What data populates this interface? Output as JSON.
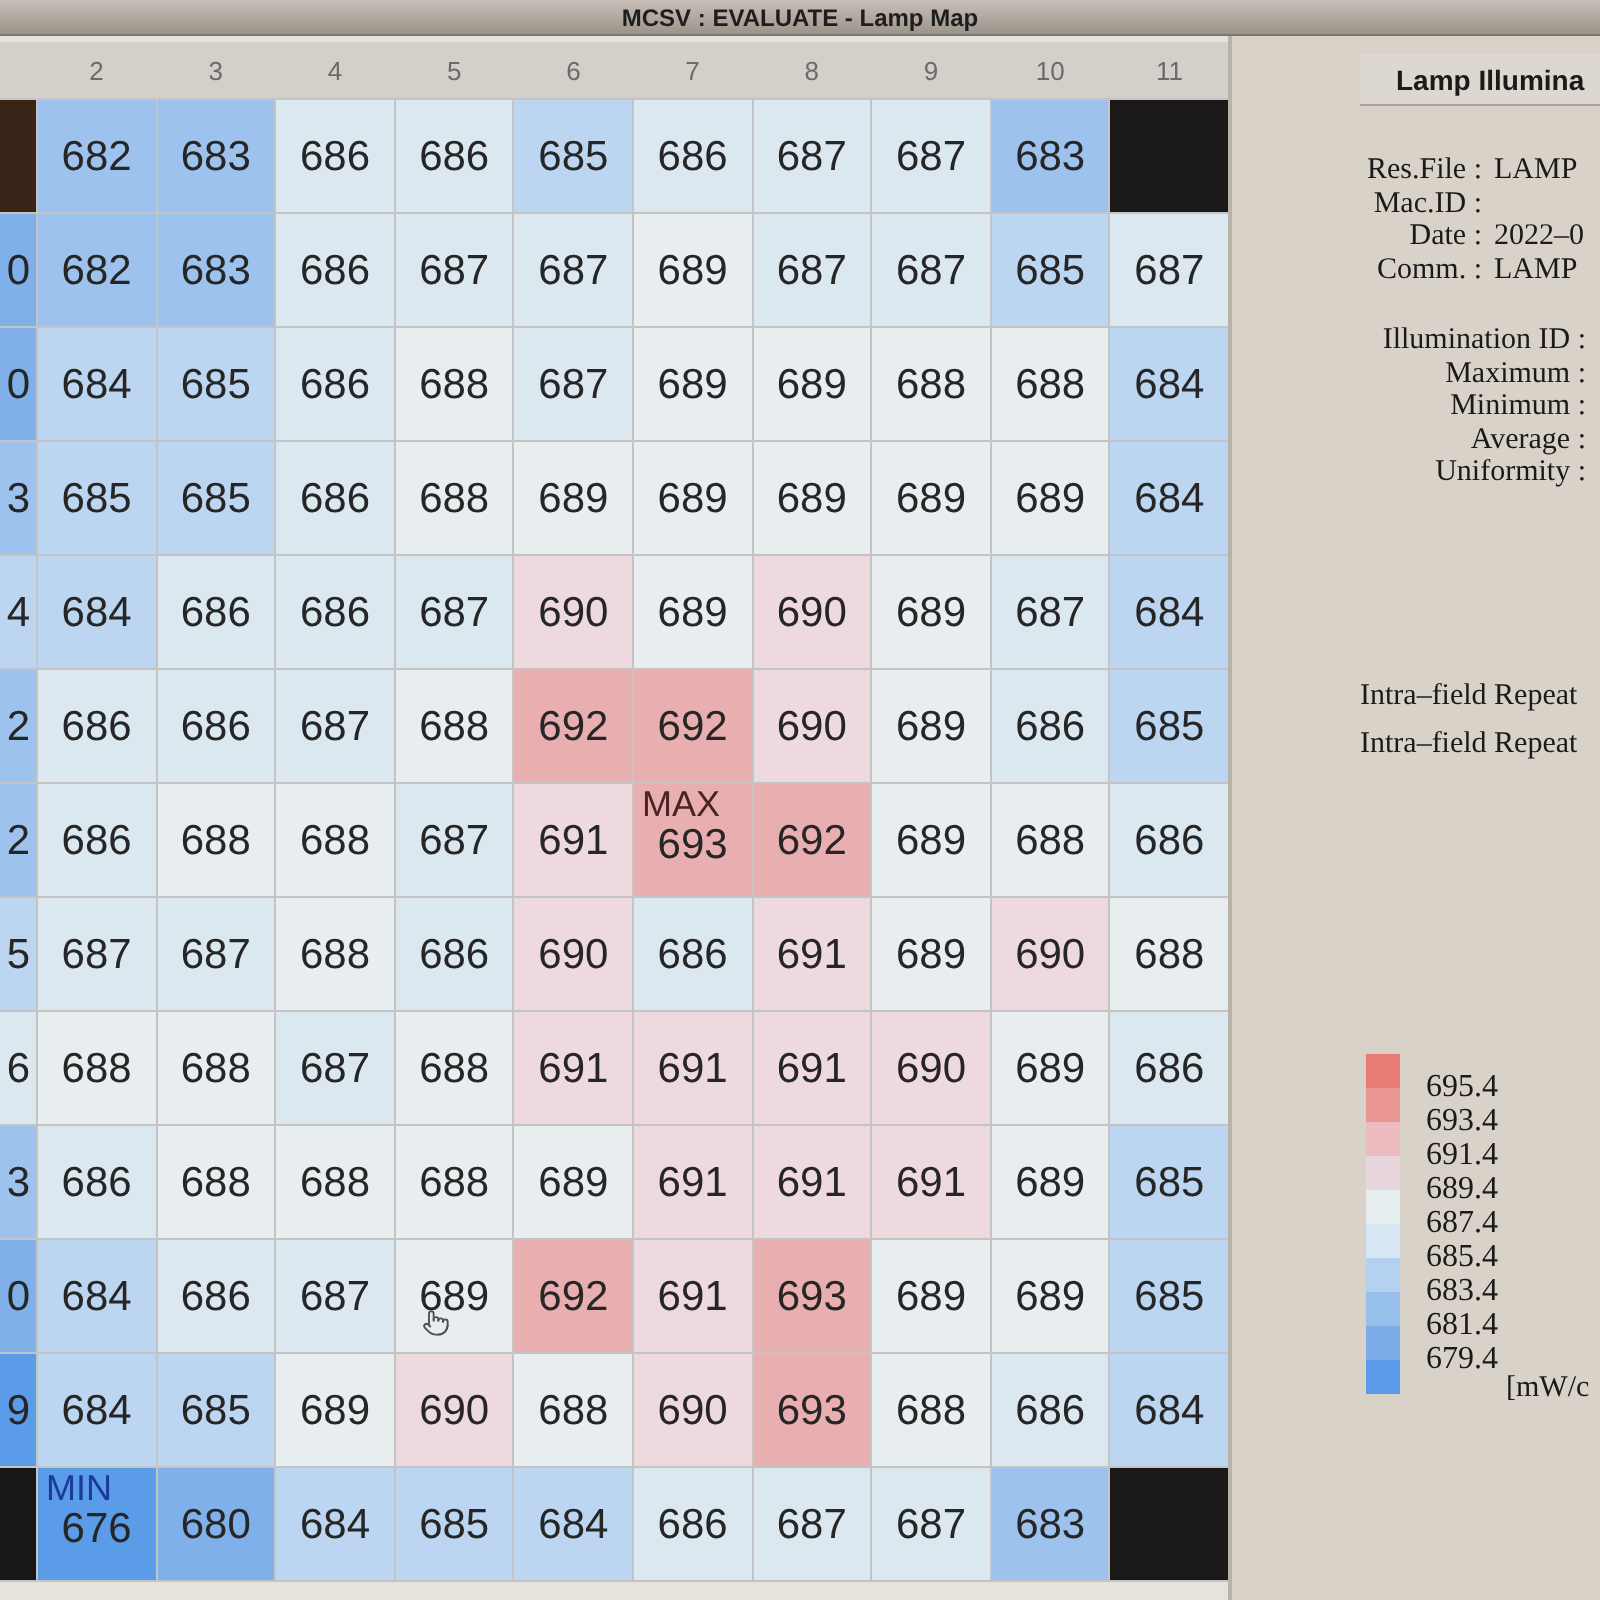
{
  "window": {
    "title": "MCSV : EVALUATE - Lamp Map"
  },
  "lamp_map": {
    "columns": [
      "",
      "2",
      "3",
      "4",
      "5",
      "6",
      "7",
      "8",
      "9",
      "10",
      "11"
    ],
    "rows": [
      {
        "cells": [
          {
            "color": "#3a2418"
          },
          {
            "value": "682",
            "color": "#9ec2ee"
          },
          {
            "value": "683",
            "color": "#9ec2ee"
          },
          {
            "value": "686",
            "color": "#dbe8f0"
          },
          {
            "value": "686",
            "color": "#dbe8f0"
          },
          {
            "value": "685",
            "color": "#bcd5f0"
          },
          {
            "value": "686",
            "color": "#dbe8f0"
          },
          {
            "value": "687",
            "color": "#dbe8f0"
          },
          {
            "value": "687",
            "color": "#dbe8f0"
          },
          {
            "value": "683",
            "color": "#9ec2ee"
          },
          {
            "color": "#1a1818"
          }
        ]
      },
      {
        "cells": [
          {
            "value": "0",
            "color": "#80b0ea"
          },
          {
            "value": "682",
            "color": "#9ec2ee"
          },
          {
            "value": "683",
            "color": "#9ec2ee"
          },
          {
            "value": "686",
            "color": "#dbe8f0"
          },
          {
            "value": "687",
            "color": "#dbe8f0"
          },
          {
            "value": "687",
            "color": "#dbe8f0"
          },
          {
            "value": "689",
            "color": "#e8edf0"
          },
          {
            "value": "687",
            "color": "#dbe8f0"
          },
          {
            "value": "687",
            "color": "#dbe8f0"
          },
          {
            "value": "685",
            "color": "#bcd5f0"
          },
          {
            "value": "687",
            "color": "#dbe8f0"
          }
        ]
      },
      {
        "cells": [
          {
            "value": "0",
            "color": "#80b0ea"
          },
          {
            "value": "684",
            "color": "#bcd5f0"
          },
          {
            "value": "685",
            "color": "#bcd5f0"
          },
          {
            "value": "686",
            "color": "#dbe8f0"
          },
          {
            "value": "688",
            "color": "#e8edf0"
          },
          {
            "value": "687",
            "color": "#dbe8f0"
          },
          {
            "value": "689",
            "color": "#e8edf0"
          },
          {
            "value": "689",
            "color": "#e8edf0"
          },
          {
            "value": "688",
            "color": "#e8edf0"
          },
          {
            "value": "688",
            "color": "#e8edf0"
          },
          {
            "value": "684",
            "color": "#bcd5f0"
          }
        ]
      },
      {
        "cells": [
          {
            "value": "3",
            "color": "#9ec2ee"
          },
          {
            "value": "685",
            "color": "#bcd5f0"
          },
          {
            "value": "685",
            "color": "#bcd5f0"
          },
          {
            "value": "686",
            "color": "#dbe8f0"
          },
          {
            "value": "688",
            "color": "#e8edf0"
          },
          {
            "value": "689",
            "color": "#e8edf0"
          },
          {
            "value": "689",
            "color": "#e8edf0"
          },
          {
            "value": "689",
            "color": "#e8edf0"
          },
          {
            "value": "689",
            "color": "#e8edf0"
          },
          {
            "value": "689",
            "color": "#e8edf0"
          },
          {
            "value": "684",
            "color": "#bcd5f0"
          }
        ]
      },
      {
        "cells": [
          {
            "value": "4",
            "color": "#bcd5f0"
          },
          {
            "value": "684",
            "color": "#bcd5f0"
          },
          {
            "value": "686",
            "color": "#dbe8f0"
          },
          {
            "value": "686",
            "color": "#dbe8f0"
          },
          {
            "value": "687",
            "color": "#dbe8f0"
          },
          {
            "value": "690",
            "color": "#eed9df"
          },
          {
            "value": "689",
            "color": "#e8edf0"
          },
          {
            "value": "690",
            "color": "#eed9df"
          },
          {
            "value": "689",
            "color": "#e8edf0"
          },
          {
            "value": "687",
            "color": "#dbe8f0"
          },
          {
            "value": "684",
            "color": "#bcd5f0"
          }
        ]
      },
      {
        "cells": [
          {
            "value": "2",
            "color": "#9ec2ee"
          },
          {
            "value": "686",
            "color": "#dbe8f0"
          },
          {
            "value": "686",
            "color": "#dbe8f0"
          },
          {
            "value": "687",
            "color": "#dbe8f0"
          },
          {
            "value": "688",
            "color": "#e8edf0"
          },
          {
            "value": "692",
            "color": "#e8aeb0"
          },
          {
            "value": "692",
            "color": "#e8aeb0"
          },
          {
            "value": "690",
            "color": "#eed9df"
          },
          {
            "value": "689",
            "color": "#e8edf0"
          },
          {
            "value": "686",
            "color": "#dbe8f0"
          },
          {
            "value": "685",
            "color": "#bcd5f0"
          }
        ]
      },
      {
        "cells": [
          {
            "value": "2",
            "color": "#9ec2ee"
          },
          {
            "value": "686",
            "color": "#dbe8f0"
          },
          {
            "value": "688",
            "color": "#e8edf0"
          },
          {
            "value": "688",
            "color": "#e8edf0"
          },
          {
            "value": "687",
            "color": "#dbe8f0"
          },
          {
            "value": "691",
            "color": "#eed9df"
          },
          {
            "value": "693",
            "color": "#e8aeb0",
            "marker": {
              "text": "MAX",
              "color": "#4a2424"
            }
          },
          {
            "value": "692",
            "color": "#e8aeb0"
          },
          {
            "value": "689",
            "color": "#e8edf0"
          },
          {
            "value": "688",
            "color": "#e8edf0"
          },
          {
            "value": "686",
            "color": "#dbe8f0"
          }
        ]
      },
      {
        "cells": [
          {
            "value": "5",
            "color": "#bcd5f0"
          },
          {
            "value": "687",
            "color": "#dbe8f0"
          },
          {
            "value": "687",
            "color": "#dbe8f0"
          },
          {
            "value": "688",
            "color": "#e8edf0"
          },
          {
            "value": "686",
            "color": "#dbe8f0"
          },
          {
            "value": "690",
            "color": "#eed9df"
          },
          {
            "value": "686",
            "color": "#dbe8f0"
          },
          {
            "value": "691",
            "color": "#eed9df"
          },
          {
            "value": "689",
            "color": "#e8edf0"
          },
          {
            "value": "690",
            "color": "#eed9df"
          },
          {
            "value": "688",
            "color": "#e8edf0"
          }
        ]
      },
      {
        "cells": [
          {
            "value": "6",
            "color": "#dbe8f0"
          },
          {
            "value": "688",
            "color": "#e8edf0"
          },
          {
            "value": "688",
            "color": "#e8edf0"
          },
          {
            "value": "687",
            "color": "#dbe8f0"
          },
          {
            "value": "688",
            "color": "#e8edf0"
          },
          {
            "value": "691",
            "color": "#eed9df"
          },
          {
            "value": "691",
            "color": "#eed9df"
          },
          {
            "value": "691",
            "color": "#eed9df"
          },
          {
            "value": "690",
            "color": "#eed9df"
          },
          {
            "value": "689",
            "color": "#e8edf0"
          },
          {
            "value": "686",
            "color": "#dbe8f0"
          }
        ]
      },
      {
        "cells": [
          {
            "value": "3",
            "color": "#9ec2ee"
          },
          {
            "value": "686",
            "color": "#dbe8f0"
          },
          {
            "value": "688",
            "color": "#e8edf0"
          },
          {
            "value": "688",
            "color": "#e8edf0"
          },
          {
            "value": "688",
            "color": "#e8edf0"
          },
          {
            "value": "689",
            "color": "#e8edf0"
          },
          {
            "value": "691",
            "color": "#eed9df"
          },
          {
            "value": "691",
            "color": "#eed9df"
          },
          {
            "value": "691",
            "color": "#eed9df"
          },
          {
            "value": "689",
            "color": "#e8edf0"
          },
          {
            "value": "685",
            "color": "#bcd5f0"
          }
        ]
      },
      {
        "cells": [
          {
            "value": "0",
            "color": "#80b0ea"
          },
          {
            "value": "684",
            "color": "#bcd5f0"
          },
          {
            "value": "686",
            "color": "#dbe8f0"
          },
          {
            "value": "687",
            "color": "#dbe8f0"
          },
          {
            "value": "689",
            "color": "#e8edf0"
          },
          {
            "value": "692",
            "color": "#e8aeb0"
          },
          {
            "value": "691",
            "color": "#eed9df"
          },
          {
            "value": "693",
            "color": "#e8aeb0"
          },
          {
            "value": "689",
            "color": "#e8edf0"
          },
          {
            "value": "689",
            "color": "#e8edf0"
          },
          {
            "value": "685",
            "color": "#bcd5f0"
          }
        ]
      },
      {
        "cells": [
          {
            "value": "9",
            "color": "#5b9ce8"
          },
          {
            "value": "684",
            "color": "#bcd5f0"
          },
          {
            "value": "685",
            "color": "#bcd5f0"
          },
          {
            "value": "689",
            "color": "#e8edf0"
          },
          {
            "value": "690",
            "color": "#eed9df"
          },
          {
            "value": "688",
            "color": "#e8edf0"
          },
          {
            "value": "690",
            "color": "#eed9df"
          },
          {
            "value": "693",
            "color": "#e8aeb0"
          },
          {
            "value": "688",
            "color": "#e8edf0"
          },
          {
            "value": "686",
            "color": "#dbe8f0"
          },
          {
            "value": "684",
            "color": "#bcd5f0"
          }
        ]
      },
      {
        "cells": [
          {
            "color": "#181616"
          },
          {
            "value": "676",
            "color": "#5b9ce8",
            "marker": {
              "text": "MIN",
              "color": "#1a3a9c"
            }
          },
          {
            "value": "680",
            "color": "#80b0ea"
          },
          {
            "value": "684",
            "color": "#bcd5f0"
          },
          {
            "value": "685",
            "color": "#bcd5f0"
          },
          {
            "value": "684",
            "color": "#bcd5f0"
          },
          {
            "value": "686",
            "color": "#dbe8f0"
          },
          {
            "value": "687",
            "color": "#dbe8f0"
          },
          {
            "value": "687",
            "color": "#dbe8f0"
          },
          {
            "value": "683",
            "color": "#9ec2ee"
          },
          {
            "color": "#1a1818"
          }
        ]
      }
    ]
  },
  "panel": {
    "title": "Lamp Illumina",
    "info": [
      {
        "label": "Res.File :",
        "value": "LAMP"
      },
      {
        "label": "Mac.ID :"
      },
      {
        "label": "Date :",
        "value": "2022–0"
      },
      {
        "label": "Comm. :",
        "value": "LAMP"
      }
    ],
    "results": [
      {
        "label": "Illumination ID :"
      },
      {
        "label": "Maximum :"
      },
      {
        "label": "Minimum :"
      },
      {
        "label": "Average :"
      },
      {
        "label": "Uniformity :"
      }
    ],
    "repeat_lines": [
      "Intra–field Repeat",
      "Intra–field Repeat"
    ],
    "legend": {
      "bands": [
        {
          "color": "#e67c74"
        },
        {
          "color": "#ea9693"
        },
        {
          "color": "#ecbcc0"
        },
        {
          "color": "#e8d6de"
        },
        {
          "color": "#e6eef0"
        },
        {
          "color": "#d6e6f2"
        },
        {
          "color": "#b4d2f0"
        },
        {
          "color": "#98c0ec"
        },
        {
          "color": "#7cade9"
        },
        {
          "color": "#5a9ae6"
        }
      ],
      "ticks": [
        "695.4",
        "693.4",
        "691.4",
        "689.4",
        "687.4",
        "685.4",
        "683.4",
        "681.4",
        "679.4"
      ],
      "unit": "[mW/c"
    }
  }
}
